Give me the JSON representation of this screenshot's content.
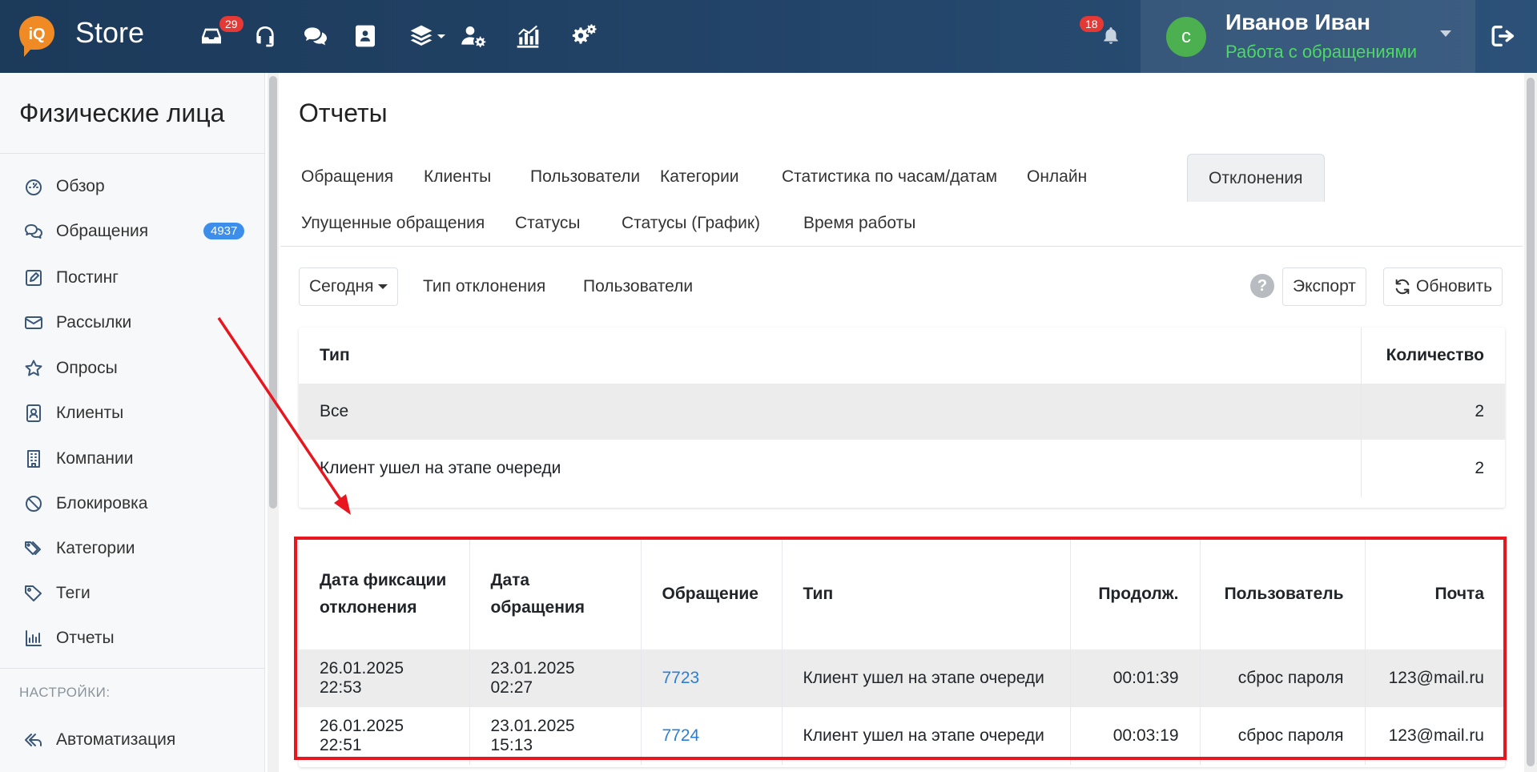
{
  "header": {
    "brand": "Store",
    "logo_text": "iQ",
    "inbox_badge": "29",
    "notifications_badge": "18",
    "user": {
      "avatar_letter": "с",
      "name": "Иванов Иван",
      "role": "Работа с обращениями"
    }
  },
  "sidebar": {
    "title": "Физические лица",
    "items": [
      {
        "label": "Обзор",
        "icon": "dashboard-icon"
      },
      {
        "label": "Обращения",
        "icon": "chat-icon",
        "badge": "4937"
      },
      {
        "label": "Постинг",
        "icon": "edit-icon"
      },
      {
        "label": "Рассылки",
        "icon": "mail-icon"
      },
      {
        "label": "Опросы",
        "icon": "star-icon"
      },
      {
        "label": "Клиенты",
        "icon": "contact-icon"
      },
      {
        "label": "Компании",
        "icon": "building-icon"
      },
      {
        "label": "Блокировка",
        "icon": "block-icon"
      },
      {
        "label": "Категории",
        "icon": "tags-icon"
      },
      {
        "label": "Теги",
        "icon": "tag-icon"
      },
      {
        "label": "Отчеты",
        "icon": "chart-icon"
      }
    ],
    "settings_label": "НАСТРОЙКИ:",
    "settings_items": [
      {
        "label": "Автоматизация",
        "icon": "automation-icon"
      }
    ]
  },
  "main": {
    "title": "Отчеты",
    "tabs_row1": [
      "Обращения",
      "Клиенты",
      "Пользователи",
      "Категории",
      "Статистика по часам/датам",
      "Онлайн",
      "Отклонения"
    ],
    "tabs_row2": [
      "Упущенные обращения",
      "Статусы",
      "Статусы (График)",
      "Время работы"
    ],
    "active_tab": "Отклонения",
    "toolbar": {
      "period": "Сегодня",
      "deviation_type": "Тип отклонения",
      "users": "Пользователи",
      "help": "?",
      "export": "Экспорт",
      "refresh": "Обновить"
    },
    "summary_table": {
      "headers": [
        "Тип",
        "Количество"
      ],
      "rows": [
        [
          "Все",
          "2"
        ],
        [
          "Клиент ушел на этапе очереди",
          "2"
        ]
      ]
    },
    "detail_table": {
      "headers": [
        "Дата фиксации отклонения",
        "Дата обращения",
        "Обращение",
        "Тип",
        "Продолж.",
        "Пользователь",
        "Почта"
      ],
      "rows": [
        [
          "26.01.2025 22:53",
          "23.01.2025 02:27",
          "7723",
          "Клиент ушел на этапе очереди",
          "00:01:39",
          "сброс пароля",
          "123@mail.ru"
        ],
        [
          "26.01.2025 22:51",
          "23.01.2025 15:13",
          "7724",
          "Клиент ушел на этапе очереди",
          "00:03:19",
          "сброс пароля",
          "123@mail.ru"
        ]
      ]
    }
  },
  "annotation": {
    "color": "#e8161f"
  }
}
